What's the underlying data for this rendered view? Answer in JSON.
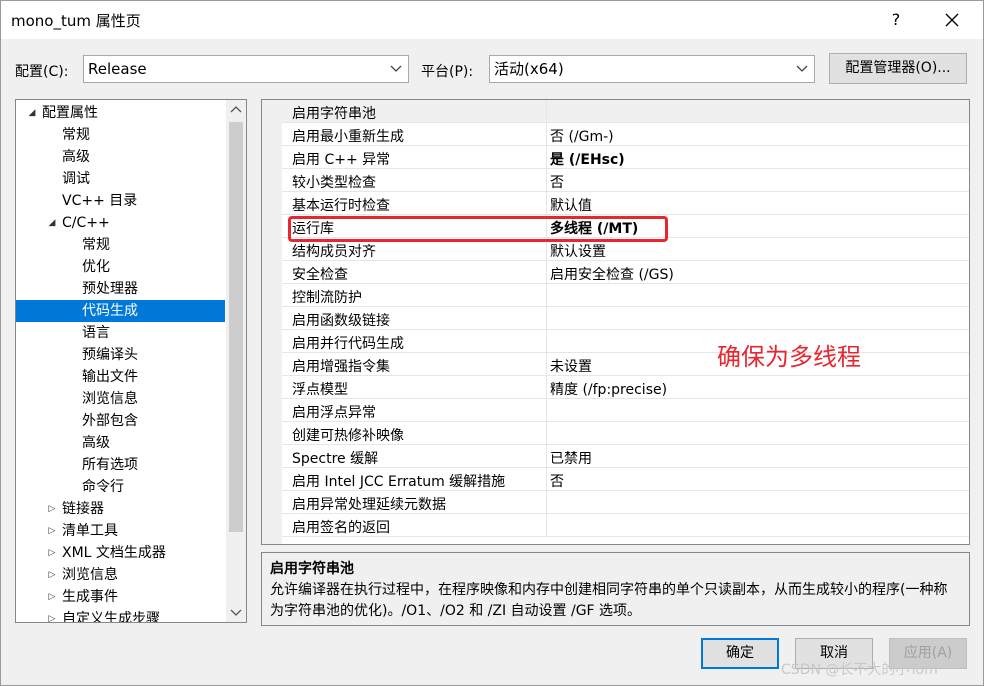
{
  "window": {
    "title": "mono_tum 属性页",
    "help_label": "?"
  },
  "config_bar": {
    "config_label": "配置(C):",
    "config_value": "Release",
    "platform_label": "平台(P):",
    "platform_value": "活动(x64)",
    "manager_button": "配置管理器(O)..."
  },
  "tree": {
    "items": [
      {
        "label": "配置属性",
        "level": 0,
        "expander": "expanded"
      },
      {
        "label": "常规",
        "level": 1,
        "expander": "none"
      },
      {
        "label": "高级",
        "level": 1,
        "expander": "none"
      },
      {
        "label": "调试",
        "level": 1,
        "expander": "none"
      },
      {
        "label": "VC++ 目录",
        "level": 1,
        "expander": "none"
      },
      {
        "label": "C/C++",
        "level": 1,
        "expander": "expanded"
      },
      {
        "label": "常规",
        "level": 2,
        "expander": "none"
      },
      {
        "label": "优化",
        "level": 2,
        "expander": "none"
      },
      {
        "label": "预处理器",
        "level": 2,
        "expander": "none"
      },
      {
        "label": "代码生成",
        "level": 2,
        "expander": "none",
        "selected": true
      },
      {
        "label": "语言",
        "level": 2,
        "expander": "none"
      },
      {
        "label": "预编译头",
        "level": 2,
        "expander": "none"
      },
      {
        "label": "输出文件",
        "level": 2,
        "expander": "none"
      },
      {
        "label": "浏览信息",
        "level": 2,
        "expander": "none"
      },
      {
        "label": "外部包含",
        "level": 2,
        "expander": "none"
      },
      {
        "label": "高级",
        "level": 2,
        "expander": "none"
      },
      {
        "label": "所有选项",
        "level": 2,
        "expander": "none"
      },
      {
        "label": "命令行",
        "level": 2,
        "expander": "none"
      },
      {
        "label": "链接器",
        "level": 1,
        "expander": "collapsed"
      },
      {
        "label": "清单工具",
        "level": 1,
        "expander": "collapsed"
      },
      {
        "label": "XML 文档生成器",
        "level": 1,
        "expander": "collapsed"
      },
      {
        "label": "浏览信息",
        "level": 1,
        "expander": "collapsed"
      },
      {
        "label": "生成事件",
        "level": 1,
        "expander": "collapsed"
      },
      {
        "label": "自定义生成步骤",
        "level": 1,
        "expander": "collapsed"
      }
    ]
  },
  "properties": [
    {
      "name": "启用字符串池",
      "value": ""
    },
    {
      "name": "启用最小重新生成",
      "value": "否 (/Gm-)"
    },
    {
      "name": "启用 C++ 异常",
      "value": "是 (/EHsc)",
      "bold": true
    },
    {
      "name": "较小类型检查",
      "value": "否"
    },
    {
      "name": "基本运行时检查",
      "value": "默认值"
    },
    {
      "name": "运行库",
      "value": "多线程 (/MT)",
      "bold": true
    },
    {
      "name": "结构成员对齐",
      "value": "默认设置"
    },
    {
      "name": "安全检查",
      "value": "启用安全检查 (/GS)"
    },
    {
      "name": "控制流防护",
      "value": ""
    },
    {
      "name": "启用函数级链接",
      "value": ""
    },
    {
      "name": "启用并行代码生成",
      "value": ""
    },
    {
      "name": "启用增强指令集",
      "value": "未设置"
    },
    {
      "name": "浮点模型",
      "value": "精度 (/fp:precise)"
    },
    {
      "name": "启用浮点异常",
      "value": ""
    },
    {
      "name": "创建可热修补映像",
      "value": ""
    },
    {
      "name": "Spectre 缓解",
      "value": "已禁用"
    },
    {
      "name": "启用 Intel JCC Erratum 缓解措施",
      "value": "否"
    },
    {
      "name": "启用异常处理延续元数据",
      "value": ""
    },
    {
      "name": "启用签名的返回",
      "value": ""
    }
  ],
  "annotation": "确保为多线程",
  "annotation_color": "#e8262e",
  "description": {
    "title": "启用字符串池",
    "text": "允许编译器在执行过程中，在程序映像和内存中创建相同字符串的单个只读副本，从而生成较小的程序(一种称为字符串池的优化)。/O1、/O2 和 /ZI 自动设置 /GF 选项。"
  },
  "buttons": {
    "ok": "确定",
    "cancel": "取消",
    "apply": "应用(A)"
  },
  "watermark": "CSDN @长不大的小Tom",
  "colors": {
    "selection": "#0078d7",
    "dialog_bg": "#f0f0f0"
  }
}
